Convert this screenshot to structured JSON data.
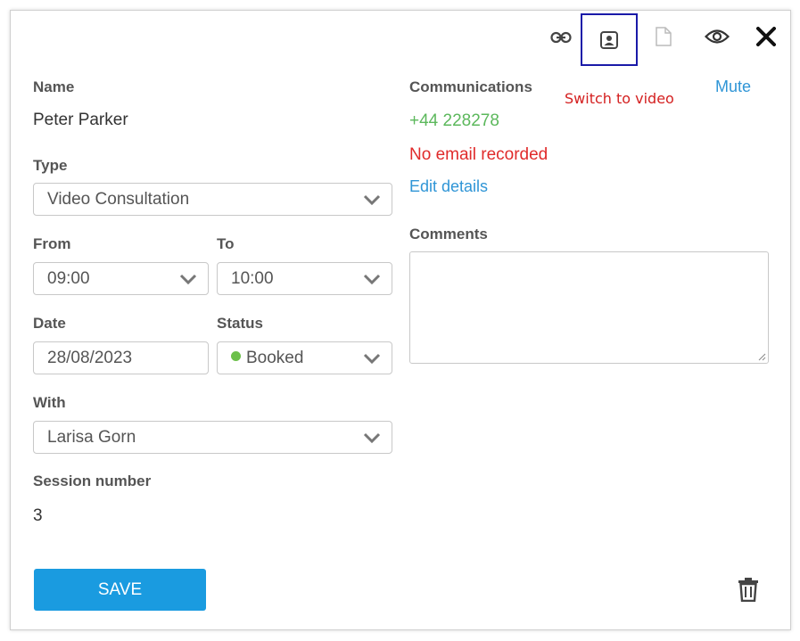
{
  "toolbar": {
    "link_icon": "link-icon",
    "video_icon": "person-video-icon",
    "document_icon": "document-icon",
    "eye_icon": "eye-icon",
    "close_icon": "close-icon"
  },
  "annotation": {
    "switch_to_video": "Switch to video",
    "mute": "Mute"
  },
  "form": {
    "name_label": "Name",
    "name_value": "Peter Parker",
    "type_label": "Type",
    "type_value": "Video Consultation",
    "from_label": "From",
    "from_value": "09:00",
    "to_label": "To",
    "to_value": "10:00",
    "date_label": "Date",
    "date_value": "28/08/2023",
    "status_label": "Status",
    "status_value": "Booked",
    "status_color": "#6cc04a",
    "with_label": "With",
    "with_value": "Larisa Gorn",
    "session_label": "Session number",
    "session_value": "3"
  },
  "communications": {
    "label": "Communications",
    "phone": "+44 228278",
    "phone_color": "#5cb85c",
    "email": "No email recorded",
    "email_color": "#e02b2b",
    "edit_link": "Edit details"
  },
  "comments": {
    "label": "Comments",
    "value": ""
  },
  "actions": {
    "save_label": "SAVE",
    "delete_icon": "trash-icon"
  },
  "colors": {
    "accent": "#1a9be0",
    "highlight_box": "#1a1aa8"
  }
}
